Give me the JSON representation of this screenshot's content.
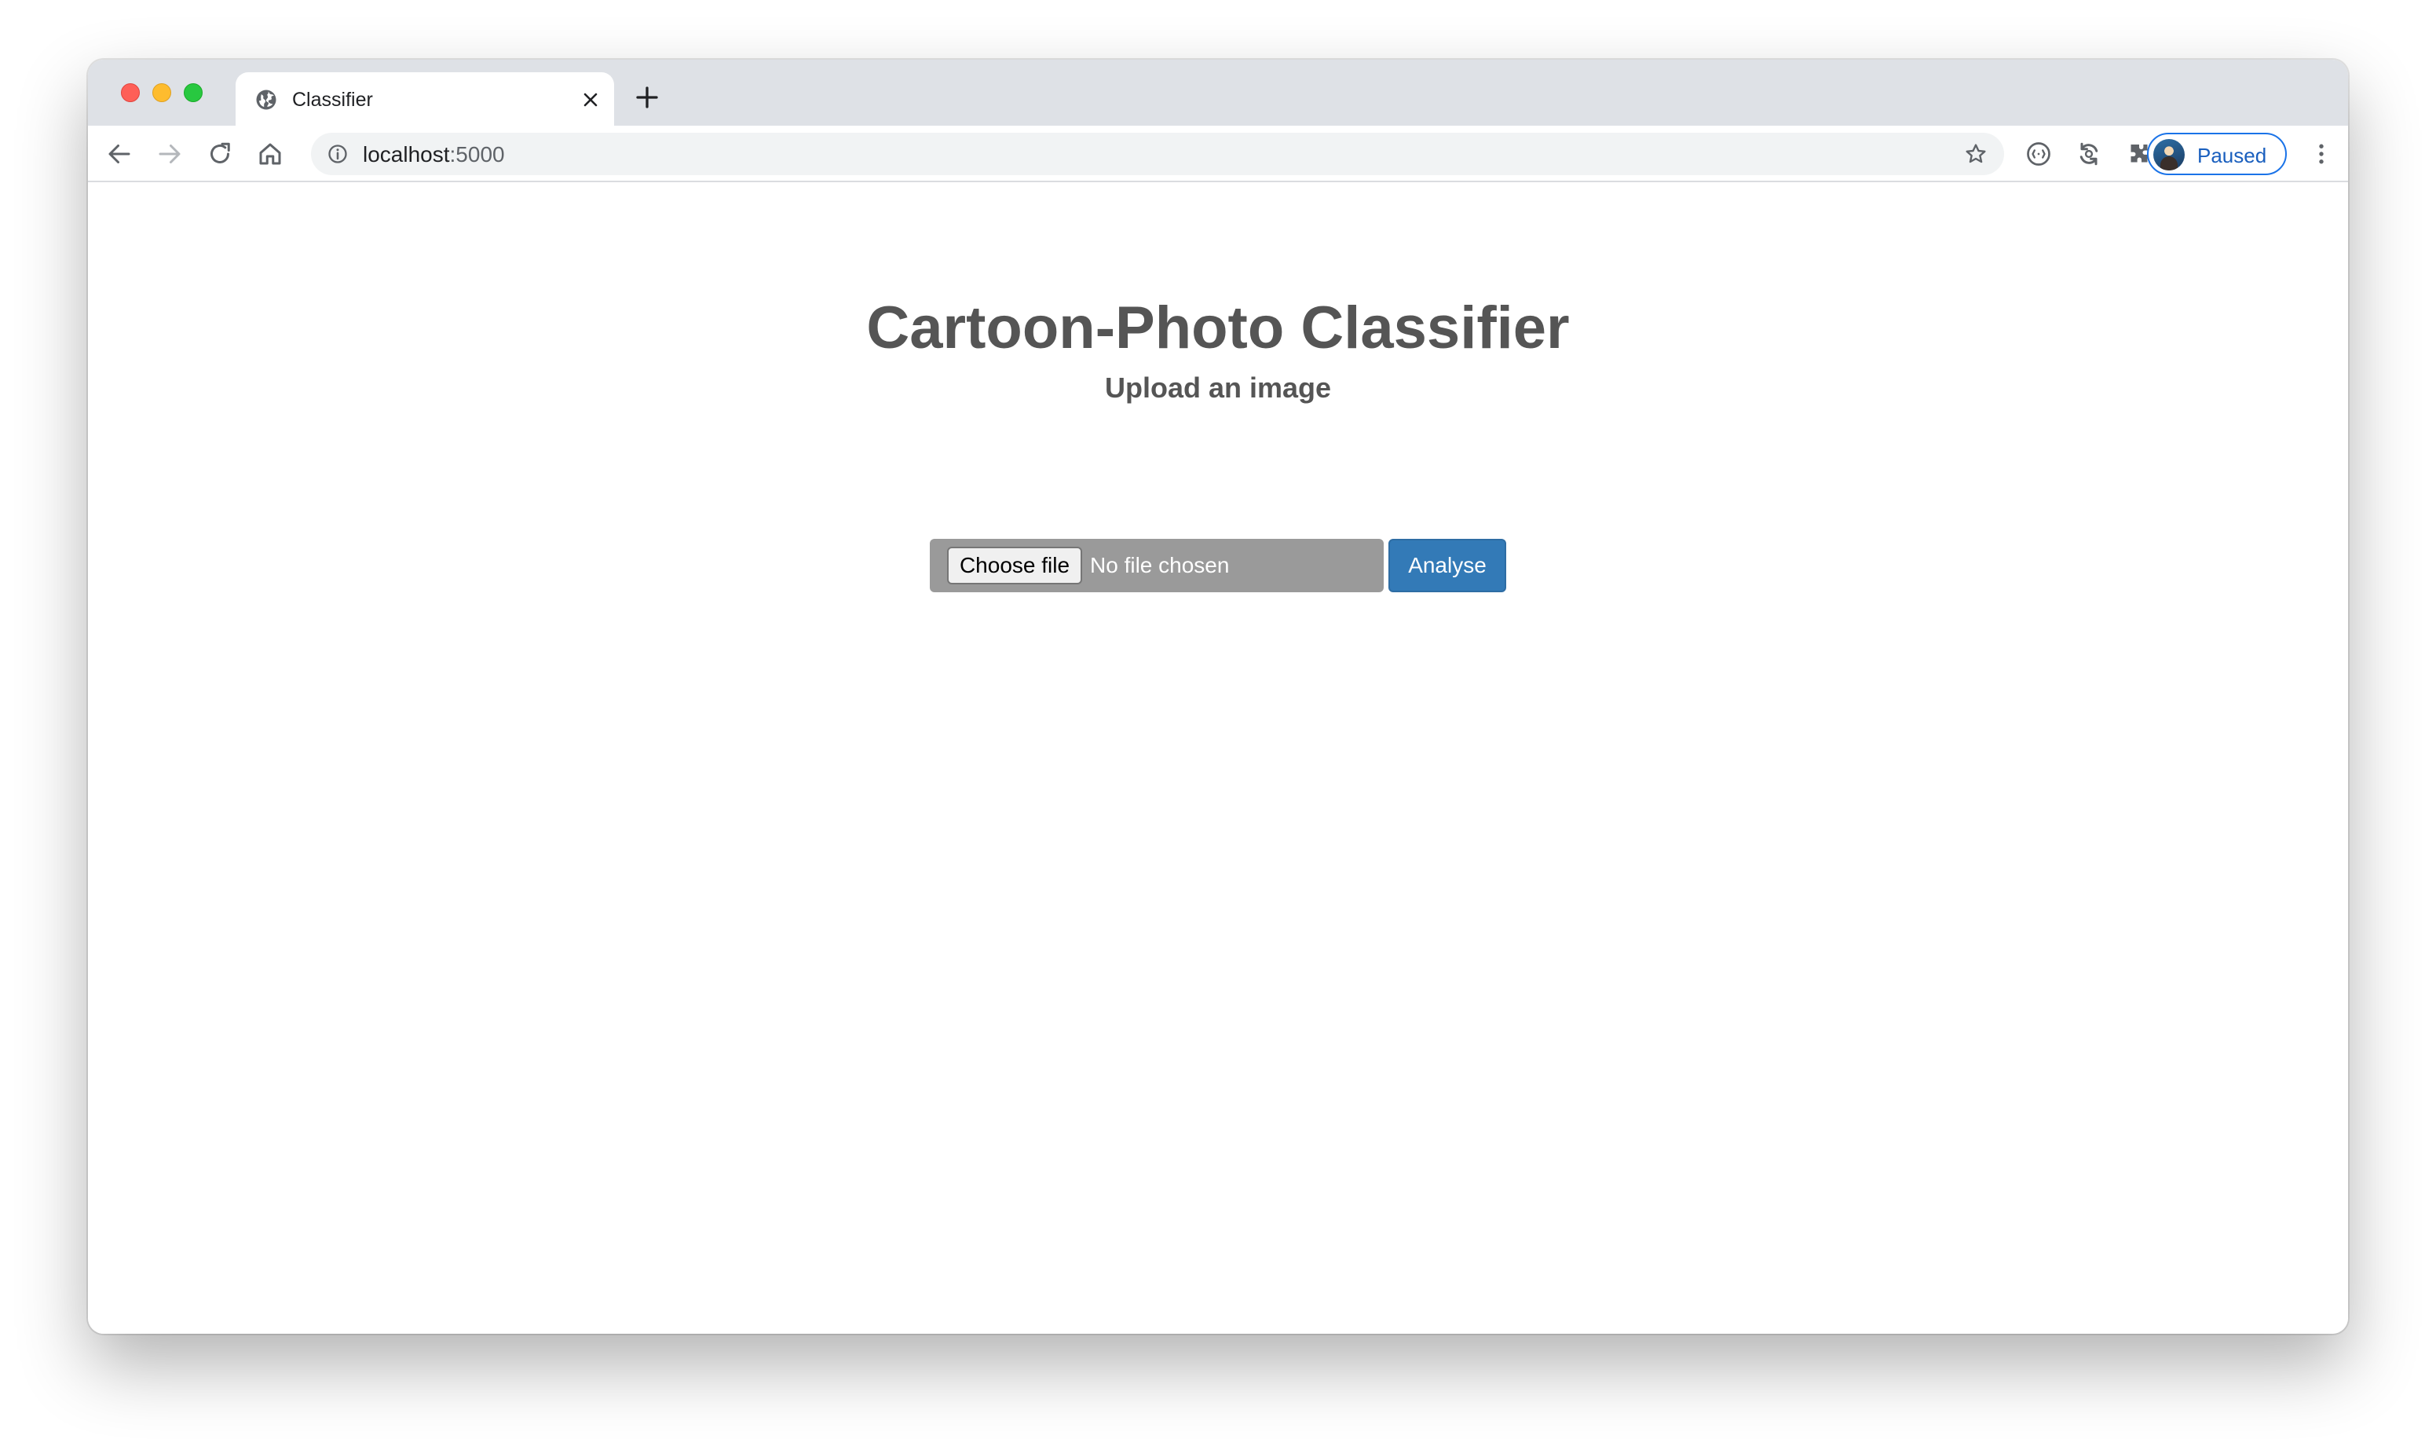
{
  "browser": {
    "tab": {
      "title": "Classifier",
      "favicon": "globe-icon"
    },
    "new_tab_icon": "plus-icon",
    "toolbar": {
      "url_host": "localhost",
      "url_port": ":5000",
      "icons": [
        "back-arrow-icon",
        "forward-arrow-icon",
        "reload-icon",
        "home-icon",
        "info-icon",
        "star-icon",
        "extension-icon",
        "sync-icon",
        "puzzle-icon",
        "kebab-menu-icon"
      ]
    },
    "profile": {
      "status": "Paused"
    }
  },
  "page": {
    "title": "Cartoon-Photo Classifier",
    "subtitle": "Upload an image",
    "file_input": {
      "button_label": "Choose file",
      "status_text": "No file chosen"
    },
    "analyse_button": "Analyse"
  },
  "colors": {
    "tabstrip": "#dee1e6",
    "omnibox": "#f1f3f4",
    "heading": "#555555",
    "file_box": "#9a9a9a",
    "primary_button": "#337ab7",
    "profile_accent": "#1a73e8"
  }
}
